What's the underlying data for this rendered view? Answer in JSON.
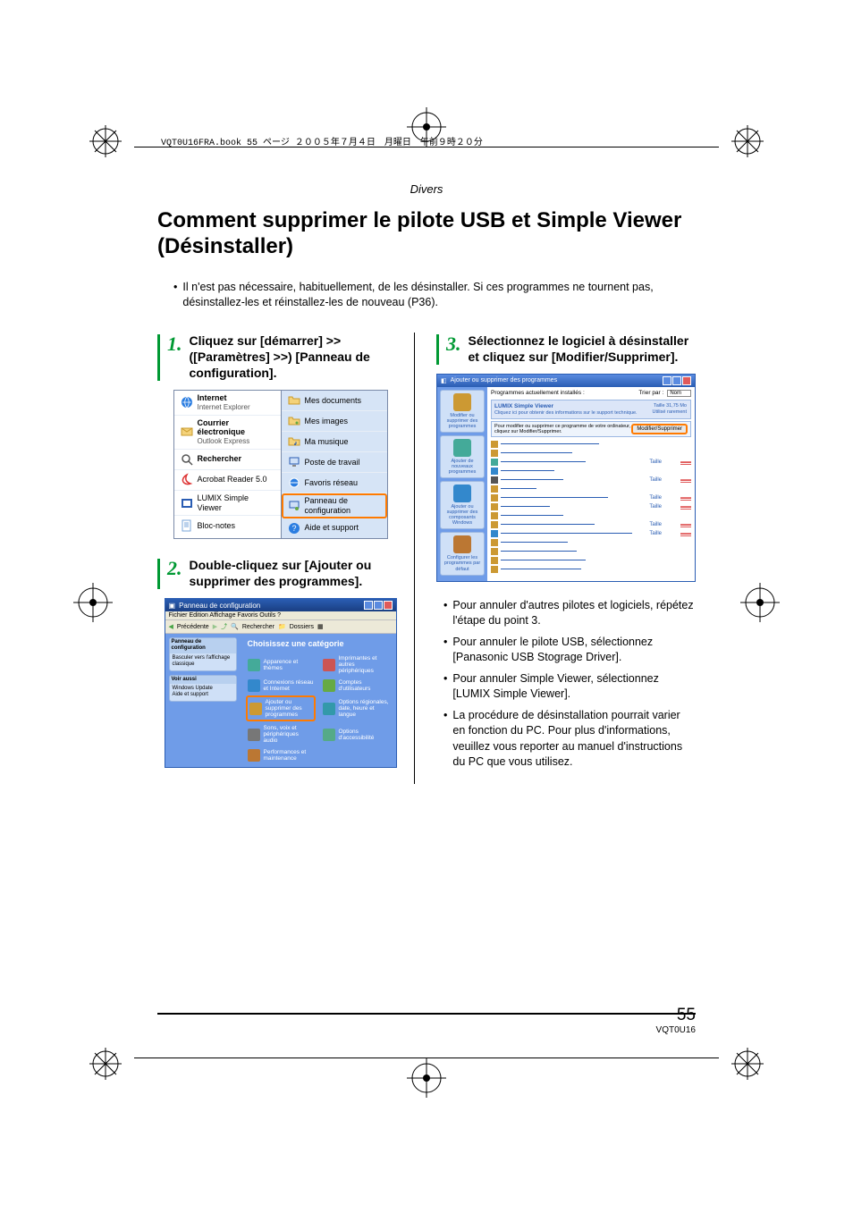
{
  "bookline": "VQT0U16FRA.book  55 ページ  ２００５年７月４日　月曜日　午前９時２０分",
  "section": "Divers",
  "title": "Comment supprimer le pilote USB et Simple Viewer (Désinstaller)",
  "intro": "Il n'est pas nécessaire, habituellement, de les désinstaller. Si ces programmes ne tournent pas, désinstallez-les et réinstallez-les de nouveau (P36).",
  "steps": {
    "s1": {
      "num": "1.",
      "title": "Cliquez sur [démarrer] >> ([Paramètres] >>) [Panneau de configuration]."
    },
    "s2": {
      "num": "2.",
      "title": "Double-cliquez sur [Ajouter ou supprimer des programmes]."
    },
    "s3": {
      "num": "3.",
      "title": "Sélectionnez le logiciel à désinstaller et cliquez sur [Modifier/Supprimer]."
    }
  },
  "bullets": {
    "b1": "Pour annuler d'autres pilotes et logiciels, répétez l'étape du point 3.",
    "b2": "Pour annuler le pilote USB, sélectionnez [Panasonic USB Stograge Driver].",
    "b3": "Pour annuler Simple Viewer, sélectionnez [LUMIX Simple Viewer].",
    "b4": "La procédure de désinstallation pourrait varier en fonction du PC. Pour plus d'informations, veuillez vous reporter au manuel d'instructions du PC que vous utilisez."
  },
  "startmenu": {
    "left": {
      "internet": "Internet",
      "internet_sub": "Internet Explorer",
      "mail": "Courrier électronique",
      "mail_sub": "Outlook Express",
      "search": "Rechercher",
      "acrobat": "Acrobat Reader 5.0",
      "lumix": "LUMIX Simple Viewer",
      "notepad": "Bloc-notes"
    },
    "right": {
      "docs": "Mes documents",
      "images": "Mes images",
      "music": "Ma musique",
      "computer": "Poste de travail",
      "network": "Favoris réseau",
      "cpanel": "Panneau de configuration",
      "help": "Aide et support"
    }
  },
  "cpanel": {
    "title": "Panneau de configuration",
    "menu": "Fichier   Edition   Affichage   Favoris   Outils   ?",
    "back": "Précédente",
    "search": "Rechercher",
    "folders": "Dossiers",
    "nav1_h": "Panneau de configuration",
    "nav1_i1": "Basculer vers l'affichage classique",
    "nav2_h": "Voir aussi",
    "nav2_i1": "Windows Update",
    "nav2_i2": "Aide et support",
    "cat_title": "Choisissez une catégorie",
    "c1": "Apparence et thèmes",
    "c2": "Imprimantes et autres périphériques",
    "c3": "Connexions réseau et Internet",
    "c4": "Comptes d'utilisateurs",
    "c5": "Ajouter ou supprimer des programmes",
    "c6": "Options régionales, date, heure et langue",
    "c7": "Sons, voix et périphériques audio",
    "c8": "Options d'accessibilité",
    "c9": "Performances et maintenance"
  },
  "arp": {
    "title": "Ajouter ou supprimer des programmes",
    "side1": "Modifier ou supprimer des programmes",
    "side2": "Ajouter de nouveaux programmes",
    "side3": "Ajouter ou supprimer des composants Windows",
    "side4": "Configurer les programmes par défaut",
    "top_label": "Programmes actuellement installés :",
    "sort_label": "Trier par :",
    "sort_value": "Nom",
    "sel_name": "LUMIX Simple Viewer",
    "sel_desc": "Cliquez ici pour obtenir des informations sur le support technique.",
    "sel_size_lbl": "Taille",
    "sel_size": "31,75 Mo",
    "sel_used_lbl": "Utilisé",
    "sel_used": "rarement",
    "remove_text": "Pour modifier ou supprimer ce programme de votre ordinateur, cliquez sur Modifier/Supprimer.",
    "remove_btn": "Modifier/Supprimer"
  },
  "page": {
    "num": "55",
    "code": "VQT0U16"
  }
}
